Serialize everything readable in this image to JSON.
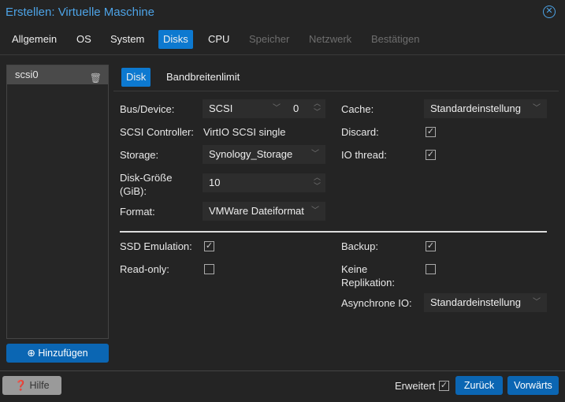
{
  "window": {
    "title": "Erstellen: Virtuelle Maschine",
    "close_icon": "close-circle-icon"
  },
  "tabs": [
    {
      "label": "Allgemein",
      "state": "normal"
    },
    {
      "label": "OS",
      "state": "normal"
    },
    {
      "label": "System",
      "state": "normal"
    },
    {
      "label": "Disks",
      "state": "active"
    },
    {
      "label": "CPU",
      "state": "normal"
    },
    {
      "label": "Speicher",
      "state": "disabled"
    },
    {
      "label": "Netzwerk",
      "state": "disabled"
    },
    {
      "label": "Bestätigen",
      "state": "disabled"
    }
  ],
  "disks": {
    "items": [
      {
        "label": "scsi0"
      }
    ],
    "add_label": "Hinzufügen"
  },
  "subtabs": [
    {
      "label": "Disk",
      "active": true
    },
    {
      "label": "Bandbreitenlimit",
      "active": false
    }
  ],
  "form": {
    "bus_label": "Bus/Device:",
    "bus_value": "SCSI",
    "device_value": "0",
    "controller_label": "SCSI Controller:",
    "controller_value": "VirtIO SCSI single",
    "storage_label": "Storage:",
    "storage_value": "Synology_Storage",
    "size_label_1": "Disk-Größe",
    "size_label_2": "(GiB):",
    "size_value": "10",
    "format_label": "Format:",
    "format_value": "VMWare Dateiformat",
    "cache_label": "Cache:",
    "cache_value": "Standardeinstellung",
    "discard_label": "Discard:",
    "discard_checked": true,
    "iothread_label": "IO thread:",
    "iothread_checked": true,
    "ssd_label": "SSD Emulation:",
    "ssd_checked": true,
    "readonly_label": "Read-only:",
    "readonly_checked": false,
    "backup_label": "Backup:",
    "backup_checked": true,
    "norepl_label_1": "Keine",
    "norepl_label_2": "Replikation:",
    "norepl_checked": false,
    "async_label": "Asynchrone IO:",
    "async_value": "Standardeinstellung"
  },
  "footer": {
    "help_label": "Hilfe",
    "advanced_label": "Erweitert",
    "advanced_checked": true,
    "back_label": "Zurück",
    "next_label": "Vorwärts"
  },
  "colors": {
    "accent": "#0d79d0",
    "title": "#4da3e6",
    "background": "#242424"
  }
}
